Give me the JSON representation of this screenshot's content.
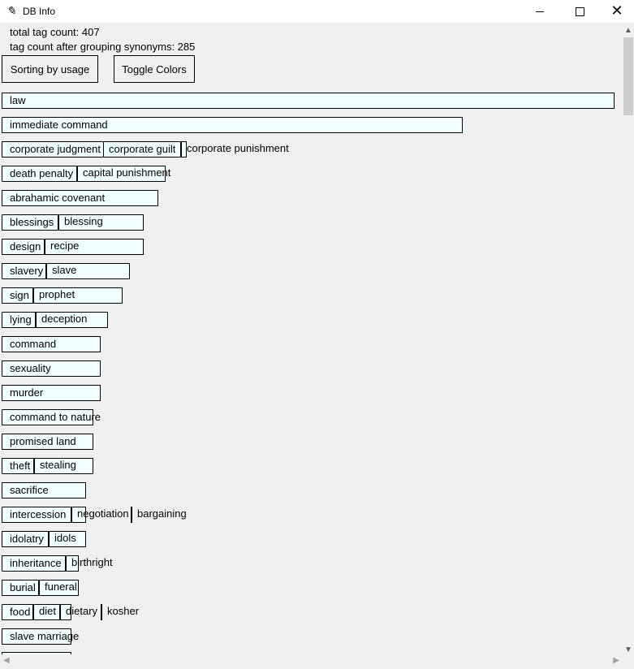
{
  "window": {
    "title": "DB Info",
    "icon": "feather-icon"
  },
  "stats": {
    "total_tag_count": "total tag count: 407",
    "grouped_tag_count": "tag count after grouping synonyms: 285"
  },
  "buttons": {
    "sort": "Sorting by usage",
    "toggle_colors": "Toggle Colors"
  },
  "colors": {
    "tag_bg": "#f0ffff",
    "window_bg": "#f0f0f0"
  },
  "tags": [
    [
      "law"
    ],
    [
      "immediate command"
    ],
    [
      "corporate judgment",
      "corporate guilt",
      "corporate punishment"
    ],
    [
      "death penalty",
      "capital punishment"
    ],
    [
      "abrahamic covenant"
    ],
    [
      "blessings",
      "blessing"
    ],
    [
      "design",
      "recipe"
    ],
    [
      "slavery",
      "slave"
    ],
    [
      "sign",
      "prophet"
    ],
    [
      "lying",
      "deception"
    ],
    [
      "command"
    ],
    [
      "sexuality"
    ],
    [
      "murder"
    ],
    [
      "command to nature"
    ],
    [
      "promised land"
    ],
    [
      "theft",
      "stealing"
    ],
    [
      "sacrifice"
    ],
    [
      "intercession",
      "negotiation",
      "bargaining"
    ],
    [
      "idolatry",
      "idols"
    ],
    [
      "inheritance",
      "birthright"
    ],
    [
      "burial",
      "funeral"
    ],
    [
      "food",
      "diet",
      "dietary",
      "kosher"
    ],
    [
      "slave marriage"
    ]
  ]
}
